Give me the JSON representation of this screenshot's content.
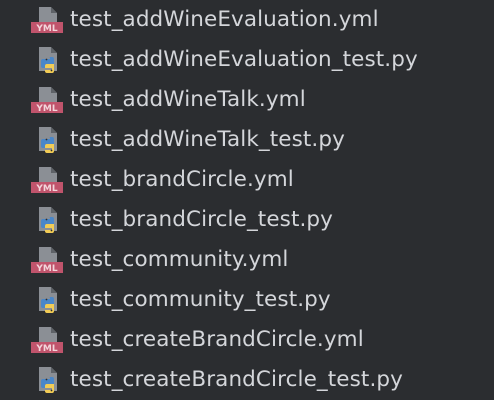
{
  "colors": {
    "background": "#2b2d30",
    "text": "#d4d6da",
    "page_icon": "#8b8f95",
    "yml_badge": "#c0546c",
    "python_blue": "#4a87c9",
    "python_yellow": "#f2cc55"
  },
  "files": [
    {
      "name": "test_addWineEvaluation.yml",
      "icon": "yml-file-icon",
      "badge": "YML"
    },
    {
      "name": "test_addWineEvaluation_test.py",
      "icon": "python-file-icon"
    },
    {
      "name": "test_addWineTalk.yml",
      "icon": "yml-file-icon",
      "badge": "YML"
    },
    {
      "name": "test_addWineTalk_test.py",
      "icon": "python-file-icon"
    },
    {
      "name": "test_brandCircle.yml",
      "icon": "yml-file-icon",
      "badge": "YML"
    },
    {
      "name": "test_brandCircle_test.py",
      "icon": "python-file-icon"
    },
    {
      "name": "test_community.yml",
      "icon": "yml-file-icon",
      "badge": "YML"
    },
    {
      "name": "test_community_test.py",
      "icon": "python-file-icon"
    },
    {
      "name": "test_createBrandCircle.yml",
      "icon": "yml-file-icon",
      "badge": "YML"
    },
    {
      "name": "test_createBrandCircle_test.py",
      "icon": "python-file-icon"
    }
  ]
}
